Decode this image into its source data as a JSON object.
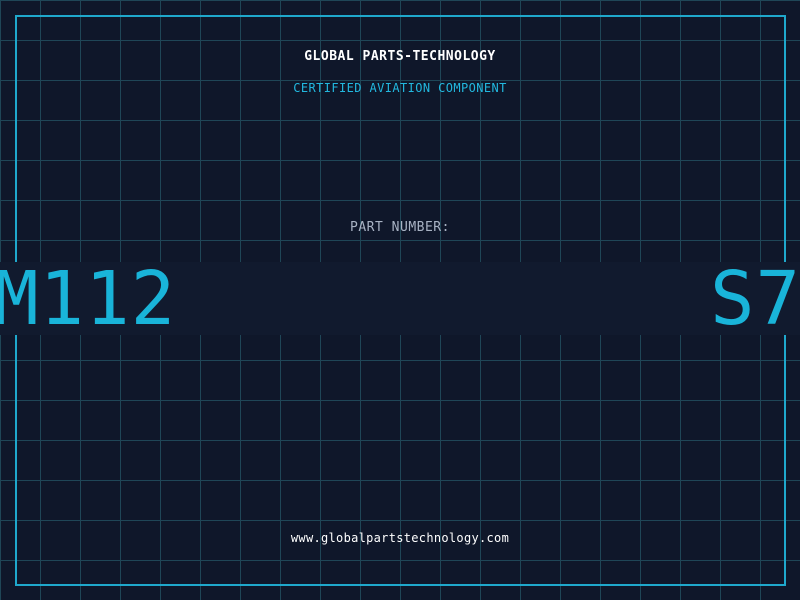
{
  "header": {
    "company": "GLOBAL PARTS-TECHNOLOGY",
    "tagline": "CERTIFIED AVIATION COMPONENT"
  },
  "part": {
    "label": "PART NUMBER:",
    "number_start": "M112",
    "number_end": "S7"
  },
  "footer": {
    "website": "www.globalpartstechnology.com"
  },
  "colors": {
    "background": "#0f172a",
    "grid": "#1f4657",
    "accent": "#1fa8cc",
    "title": "#ffffff",
    "label": "#a9b3c4"
  }
}
